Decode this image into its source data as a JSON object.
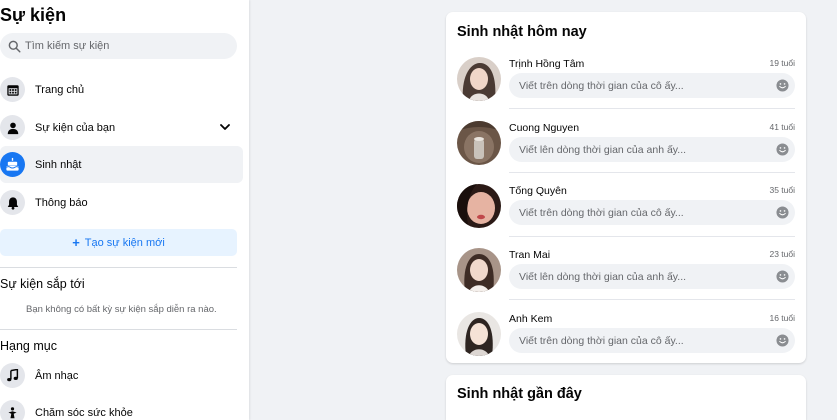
{
  "sidebar": {
    "title": "Sự kiện",
    "search_placeholder": "Tìm kiếm sự kiện",
    "nav": [
      {
        "label": "Trang chủ",
        "icon": "calendar-icon"
      },
      {
        "label": "Sự kiện của bạn",
        "icon": "person-icon"
      },
      {
        "label": "Sinh nhật",
        "icon": "birthday-cake-icon"
      },
      {
        "label": "Thông báo",
        "icon": "bell-icon"
      }
    ],
    "create_event_label": "Tạo sự kiện mới",
    "upcoming_title": "Sự kiện sắp tới",
    "upcoming_empty": "Bạn không có bất kỳ sự kiện sắp diễn ra nào.",
    "categories_title": "Hạng mục",
    "categories": [
      {
        "label": "Âm nhạc",
        "icon": "music-note-icon"
      },
      {
        "label": "Chăm sóc sức khỏe",
        "icon": "health-icon"
      }
    ]
  },
  "birthdays_today": {
    "title": "Sinh nhật hôm nay",
    "people": [
      {
        "name": "Trịnh Hồng Tâm",
        "age": "19 tuổi",
        "placeholder": "Viết trên dòng thời gian của cô ấy..."
      },
      {
        "name": "Cuong Nguyen",
        "age": "41 tuổi",
        "placeholder": "Viết lên dòng thời gian của anh ấy..."
      },
      {
        "name": "Tống Quyên",
        "age": "35 tuổi",
        "placeholder": "Viết trên dòng thời gian của cô ấy..."
      },
      {
        "name": "Tran Mai",
        "age": "23 tuổi",
        "placeholder": "Viết lên dòng thời gian của anh ấy..."
      },
      {
        "name": "Anh Kem",
        "age": "16 tuổi",
        "placeholder": "Viết trên dòng thời gian của cô ấy..."
      }
    ]
  },
  "recent_birthdays": {
    "title": "Sinh nhật gần đây"
  },
  "colors": {
    "accent": "#1877f2",
    "accent_light": "#e7f3ff",
    "background": "#f0f2f5",
    "text_secondary": "#65676b"
  }
}
